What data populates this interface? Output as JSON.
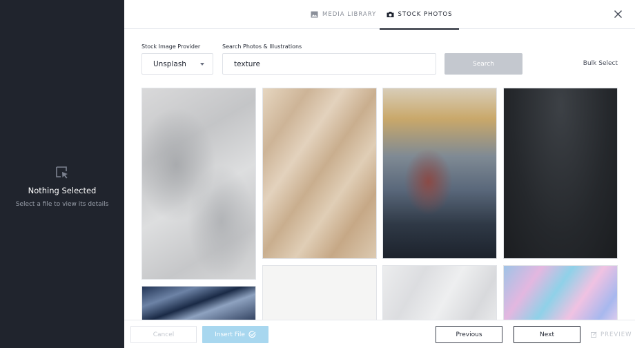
{
  "sidebar": {
    "empty_icon": "cursor-select-icon",
    "empty_title": "Nothing Selected",
    "empty_subtitle": "Select a file to view its details"
  },
  "tabs": [
    {
      "label": "MEDIA LIBRARY",
      "icon": "image-icon",
      "active": false
    },
    {
      "label": "STOCK PHOTOS",
      "icon": "camera-icon",
      "active": true
    }
  ],
  "form": {
    "provider_label": "Stock Image Provider",
    "provider_value": "Unsplash",
    "search_label": "Search Photos & Illustrations",
    "search_value": "texture",
    "search_button": "Search",
    "bulk_select": "Bulk Select"
  },
  "photos": [
    {
      "name": "photo-grey-marble"
    },
    {
      "name": "photo-crumpled-paper"
    },
    {
      "name": "photo-frosted-glass"
    },
    {
      "name": "photo-dark-gradient"
    },
    {
      "name": "photo-blue-ice"
    },
    {
      "name": "photo-white-paper"
    },
    {
      "name": "photo-white-plaster"
    },
    {
      "name": "photo-pastel-fluid"
    }
  ],
  "footer": {
    "cancel": "Cancel",
    "insert": "Insert File",
    "previous": "Previous",
    "next": "Next",
    "preview": "PREVIEW"
  },
  "colors": {
    "sidebar_bg": "#20242d",
    "search_button_bg": "#c4c8cf",
    "insert_button_bg": "#a8d7ef"
  }
}
